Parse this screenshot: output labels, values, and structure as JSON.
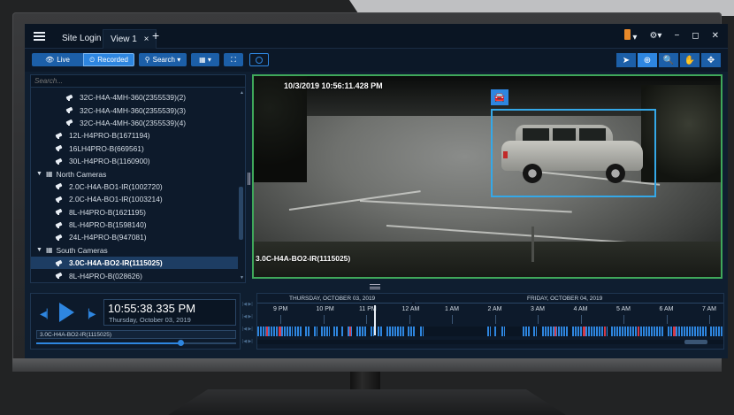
{
  "titlebar": {
    "menu_icon": "hamburger-icon",
    "tabs": [
      {
        "label": "Site Login"
      },
      {
        "label": "View 1"
      }
    ],
    "close_tab_glyph": "×",
    "add_tab_glyph": "+",
    "window_controls": {
      "settings_glyph": "⚙▾",
      "minimize_glyph": "−",
      "maximize_glyph": "◻",
      "close_glyph": "✕"
    }
  },
  "toolbar": {
    "live_label": "Live",
    "recorded_label": "Recorded",
    "search_label": "Search ▾",
    "layout_glyph": "▦ ▾",
    "fullscreen_glyph": "⛶",
    "right_tools": [
      "➤",
      "⊕",
      "🔍",
      "✋",
      "✥"
    ]
  },
  "sidebar": {
    "search_placeholder": "Search...",
    "items": [
      {
        "label": "32C-H4A-4MH-360(2355539)(2)",
        "level": "camera2"
      },
      {
        "label": "32C-H4A-4MH-360(2355539)(3)",
        "level": "camera2"
      },
      {
        "label": "32C-H4A-4MH-360(2355539)(4)",
        "level": "camera2"
      },
      {
        "label": "12L-H4PRO-B(1671194)",
        "level": "camera1"
      },
      {
        "label": "16LH4PRO-B(669561)",
        "level": "camera1"
      },
      {
        "label": "30L-H4PRO-B(1160900)",
        "level": "camera1"
      },
      {
        "label": "North Cameras",
        "level": "group"
      },
      {
        "label": "2.0C-H4A-BO1-IR(1002720)",
        "level": "camera1"
      },
      {
        "label": "2.0C-H4A-BO1-IR(1003214)",
        "level": "camera1"
      },
      {
        "label": "8L-H4PRO-B(1621195)",
        "level": "camera1"
      },
      {
        "label": "8L-H4PRO-B(1598140)",
        "level": "camera1"
      },
      {
        "label": "24L-H4PRO-B(947081)",
        "level": "camera1"
      },
      {
        "label": "South Cameras",
        "level": "group"
      },
      {
        "label": "3.0C-H4A-BO2-IR(1115025)",
        "level": "camera1",
        "selected": true
      },
      {
        "label": "8L-H4PRO-B(028626)",
        "level": "camera1"
      }
    ]
  },
  "video": {
    "timestamp": "10/3/2019 10:56:11.428 PM",
    "camera_label": "3.0C-H4A-BO2-IR(1115025)",
    "detection_icon": "car-icon",
    "border_color": "#3fa75a",
    "detection_color": "#34a8e8"
  },
  "playback": {
    "time": "10:55:38.335 PM",
    "date": "Thursday, October 03, 2019",
    "camera": "3.0C-H4A-BO2-IR(1115025)",
    "speed_position": 0.72
  },
  "timeline": {
    "days": [
      "THURSDAY, OCTOBER 03, 2019",
      "FRIDAY, OCTOBER 04, 2019"
    ],
    "hours": [
      "9 PM",
      "10 PM",
      "11 PM",
      "12 AM",
      "1 AM",
      "2 AM",
      "3 AM",
      "4 AM",
      "5 AM",
      "6 AM",
      "7 AM"
    ],
    "colors": {
      "recording": "#2e86e0",
      "event": "#d23a4a"
    }
  }
}
